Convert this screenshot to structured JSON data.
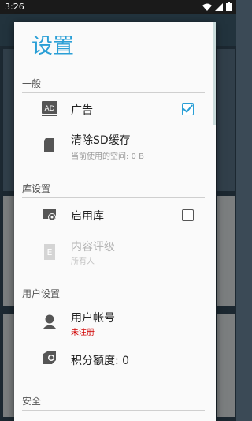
{
  "status_bar": {
    "time": "3:26"
  },
  "dialog": {
    "title": "设置",
    "sections": {
      "general": {
        "header": "一般",
        "ads": {
          "label": "广告",
          "checked": true
        },
        "clear_sd": {
          "label": "清除SD缓存",
          "sub": "当前使用的空间: 0 B"
        }
      },
      "library": {
        "header": "库设置",
        "enable_library": {
          "label": "启用库",
          "checked": false
        },
        "content_rating": {
          "label": "内容评级",
          "sub": "所有人",
          "disabled": true
        }
      },
      "user": {
        "header": "用户设置",
        "account": {
          "label": "用户帐号",
          "sub": "未注册"
        },
        "points": {
          "label": "积分额度: 0"
        }
      },
      "security": {
        "header": "安全"
      }
    }
  },
  "colors": {
    "accent": "#2a9fd6",
    "warning": "#d00000"
  },
  "icons": [
    "wifi-icon",
    "signal-icon",
    "battery-icon",
    "ad-icon",
    "sd-card-icon",
    "library-settings-icon",
    "rating-icon",
    "user-icon",
    "points-icon"
  ]
}
